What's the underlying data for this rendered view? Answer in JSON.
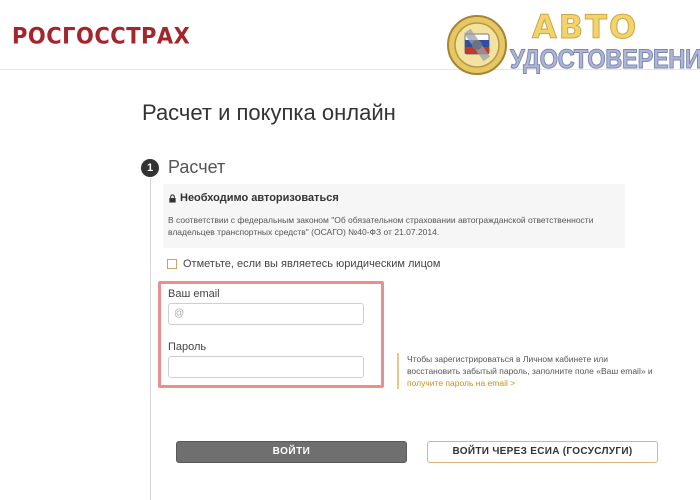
{
  "header": {
    "logo_text": "РОСГОССТРАХ",
    "watermark_line1": "АВТО",
    "watermark_line2": "УДОСТОВЕРЕНИЕ"
  },
  "page": {
    "title": "Расчет и покупка онлайн"
  },
  "step": {
    "number": "1",
    "title": "Расчет"
  },
  "auth": {
    "heading": "Необходимо авторизоваться",
    "notice": "В соответствии с федеральным законом \"Об обязательном страховании автогражданской ответственности владельцев транспортных средств\" (ОСАГО) №40-ФЗ от 21.07.2014."
  },
  "legal_entity_checkbox": {
    "label": "Отметьте, если вы являетесь юридическим лицом",
    "checked": false
  },
  "form": {
    "email_label": "Ваш email",
    "email_placeholder": "@",
    "email_value": "",
    "password_label": "Пароль",
    "password_value": ""
  },
  "hint": {
    "text": "Чтобы зарегистрироваться в Личном кабинете или восстановить забытый пароль, заполните поле «Ваш email» и",
    "link": "получите пароль на email >"
  },
  "buttons": {
    "login": "ВОЙТИ",
    "esia": "ВОЙТИ ЧЕРЕЗ ЕСИА (ГОСУСЛУГИ)"
  },
  "colors": {
    "brand": "#a4262c",
    "highlight": "#ec8f8c",
    "accent": "#c7901f"
  }
}
